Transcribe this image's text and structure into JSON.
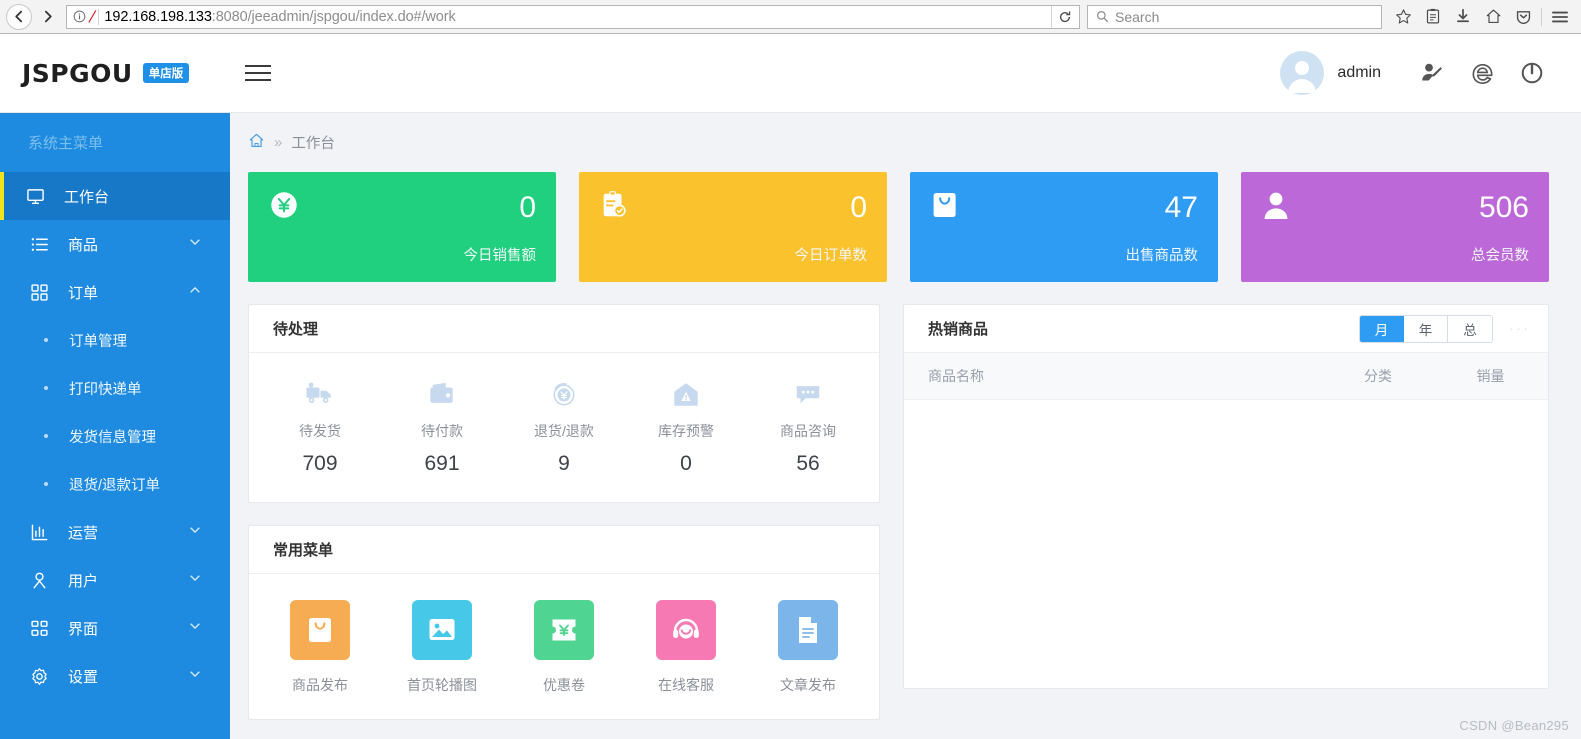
{
  "browser": {
    "back_label": "◀",
    "forward_label": "▶",
    "info_icon": "info-icon",
    "url_host": "192.168.198.133",
    "url_rest": ":8080/jeeadmin/jspgou/index.do#/work",
    "url_full": "192.168.198.133:8080/jeeadmin/jspgou/index.do#/work",
    "reload_label": "⟳",
    "search_placeholder": "Search",
    "toolbar_icons": [
      "bookmark-star-icon",
      "library-icon",
      "downloads-icon",
      "home-icon",
      "pocket-icon",
      "menu-icon"
    ]
  },
  "header": {
    "logo": "JSPGOU",
    "logo_badge": "单店版",
    "menu_toggle": "hamburger-icon",
    "user_name": "admin",
    "icons": [
      "user-edit-icon",
      "browser-e-icon",
      "power-icon"
    ]
  },
  "sidebar": {
    "title": "系统主菜单",
    "items": [
      {
        "label": "工作台",
        "icon": "monitor-icon",
        "active": true,
        "arrow": ""
      },
      {
        "label": "商品",
        "icon": "list-icon",
        "active": false,
        "arrow": "chevron-down"
      },
      {
        "label": "订单",
        "icon": "grid-icon",
        "active": false,
        "arrow": "chevron-up"
      }
    ],
    "submenu": [
      {
        "label": "订单管理"
      },
      {
        "label": "打印快递单"
      },
      {
        "label": "发货信息管理"
      },
      {
        "label": "退货/退款订单"
      }
    ],
    "items_bottom": [
      {
        "label": "运营",
        "icon": "chart-icon",
        "arrow": "chevron-down"
      },
      {
        "label": "用户",
        "icon": "person-icon",
        "arrow": "chevron-down"
      },
      {
        "label": "界面",
        "icon": "layout-icon",
        "arrow": "chevron-down"
      },
      {
        "label": "设置",
        "icon": "gear-icon",
        "arrow": "chevron-down"
      }
    ]
  },
  "breadcrumb": {
    "home_icon": "home-icon",
    "separator": "»",
    "current": "工作台"
  },
  "stats": [
    {
      "value": "0",
      "label": "今日销售额",
      "icon": "yuan-circle-icon",
      "color": "#20d07e"
    },
    {
      "value": "0",
      "label": "今日订单数",
      "icon": "clipboard-check-icon",
      "color": "#fac22d"
    },
    {
      "value": "47",
      "label": "出售商品数",
      "icon": "shopping-bag-icon",
      "color": "#2f9cf4"
    },
    {
      "value": "506",
      "label": "总会员数",
      "icon": "person-icon",
      "color": "#bd68d8"
    }
  ],
  "todo_panel": {
    "title": "待处理",
    "items": [
      {
        "label": "待发货",
        "value": "709",
        "icon": "truck-icon"
      },
      {
        "label": "待付款",
        "value": "691",
        "icon": "wallet-icon"
      },
      {
        "label": "退货/退款",
        "value": "9",
        "icon": "refund-yuan-icon"
      },
      {
        "label": "库存预警",
        "value": "0",
        "icon": "warehouse-warning-icon"
      },
      {
        "label": "商品咨询",
        "value": "56",
        "icon": "chat-bubble-icon"
      }
    ]
  },
  "shortcut_panel": {
    "title": "常用菜单",
    "items": [
      {
        "label": "商品发布",
        "icon": "shopping-bag-icon",
        "color": "#f5ac52"
      },
      {
        "label": "首页轮播图",
        "icon": "image-icon",
        "color": "#46c8e8"
      },
      {
        "label": "优惠卷",
        "icon": "coupon-yuan-icon",
        "color": "#4fd491"
      },
      {
        "label": "在线客服",
        "icon": "headset-icon",
        "color": "#f779b4"
      },
      {
        "label": "文章发布",
        "icon": "document-icon",
        "color": "#7cb5ea"
      }
    ]
  },
  "hot_panel": {
    "title": "热销商品",
    "toggles": [
      {
        "label": "月",
        "active": true
      },
      {
        "label": "年",
        "active": false
      },
      {
        "label": "总",
        "active": false
      }
    ],
    "more": "···",
    "columns": [
      "商品名称",
      "分类",
      "销量"
    ],
    "rows": []
  },
  "watermark": "CSDN @Bean295"
}
